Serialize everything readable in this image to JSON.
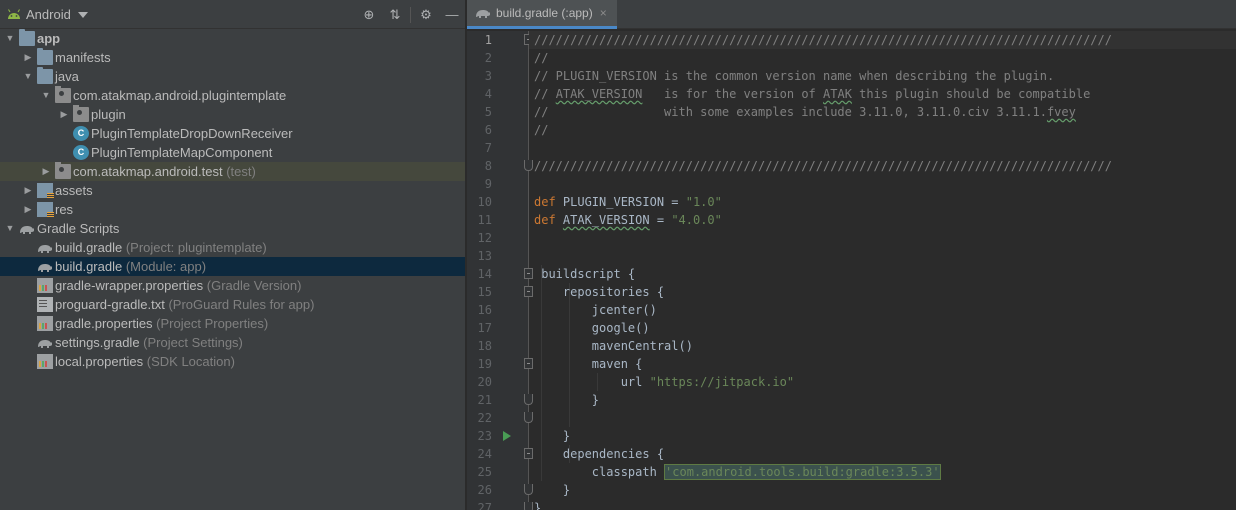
{
  "project_panel": {
    "view_label": "Android",
    "tools": [
      {
        "name": "locate-icon",
        "glyph": "⊕"
      },
      {
        "name": "collapse-all-icon",
        "glyph": "⇅"
      },
      {
        "name": "gear-icon",
        "glyph": "⚙"
      },
      {
        "name": "hide-icon",
        "glyph": "—"
      }
    ],
    "tree": [
      {
        "depth": 0,
        "arrow": "▼",
        "icon": "module",
        "label": "app",
        "hint": "",
        "bold": true
      },
      {
        "depth": 1,
        "arrow": "▶",
        "icon": "folder",
        "label": "manifests",
        "hint": ""
      },
      {
        "depth": 1,
        "arrow": "▼",
        "icon": "folder",
        "label": "java",
        "hint": ""
      },
      {
        "depth": 2,
        "arrow": "▼",
        "icon": "package",
        "label": "com.atakmap.android.plugintemplate",
        "hint": ""
      },
      {
        "depth": 3,
        "arrow": "▶",
        "icon": "package",
        "label": "plugin",
        "hint": ""
      },
      {
        "depth": 3,
        "arrow": "",
        "icon": "class",
        "label": "PluginTemplateDropDownReceiver",
        "hint": ""
      },
      {
        "depth": 3,
        "arrow": "",
        "icon": "class",
        "label": "PluginTemplateMapComponent",
        "hint": ""
      },
      {
        "depth": 2,
        "arrow": "▶",
        "icon": "package",
        "label": "com.atakmap.android.test",
        "hint": "(test)",
        "state": "test"
      },
      {
        "depth": 1,
        "arrow": "▶",
        "icon": "res",
        "label": "assets",
        "hint": ""
      },
      {
        "depth": 1,
        "arrow": "▶",
        "icon": "res",
        "label": "res",
        "hint": ""
      },
      {
        "depth": 0,
        "arrow": "▼",
        "icon": "gradle",
        "label": "Gradle Scripts",
        "hint": ""
      },
      {
        "depth": 1,
        "arrow": "",
        "icon": "gradle",
        "label": "build.gradle",
        "hint": "(Project: plugintemplate)"
      },
      {
        "depth": 1,
        "arrow": "",
        "icon": "gradle",
        "label": "build.gradle",
        "hint": "(Module: app)",
        "state": "selected"
      },
      {
        "depth": 1,
        "arrow": "",
        "icon": "props",
        "label": "gradle-wrapper.properties",
        "hint": "(Gradle Version)"
      },
      {
        "depth": 1,
        "arrow": "",
        "icon": "txt",
        "label": "proguard-gradle.txt",
        "hint": "(ProGuard Rules for app)"
      },
      {
        "depth": 1,
        "arrow": "",
        "icon": "props",
        "label": "gradle.properties",
        "hint": "(Project Properties)"
      },
      {
        "depth": 1,
        "arrow": "",
        "icon": "gradle",
        "label": "settings.gradle",
        "hint": "(Project Settings)"
      },
      {
        "depth": 1,
        "arrow": "",
        "icon": "props",
        "label": "local.properties",
        "hint": "(SDK Location)"
      }
    ]
  },
  "editor": {
    "tab_label": "build.gradle (:app)",
    "tab_close": "×",
    "current_line": 1,
    "run_marker_line": 23,
    "lines": [
      [
        {
          "t": "////////////////////////////////////////////////////////////////////////////////",
          "c": "comment"
        }
      ],
      [
        {
          "t": "//",
          "c": "comment"
        }
      ],
      [
        {
          "t": "// PLUGIN_VERSION is the common version name when describing the plugin.",
          "c": "comment"
        }
      ],
      [
        {
          "t": "// ",
          "c": "comment"
        },
        {
          "t": "ATAK_VERSION",
          "c": "comment typo"
        },
        {
          "t": "   is for the version of ",
          "c": "comment"
        },
        {
          "t": "ATAK",
          "c": "comment typo"
        },
        {
          "t": " this plugin should be compatible",
          "c": "comment"
        }
      ],
      [
        {
          "t": "//                with some examples include 3.11.0, 3.11.0.civ 3.11.1.",
          "c": "comment"
        },
        {
          "t": "fvey",
          "c": "comment typo"
        }
      ],
      [
        {
          "t": "//",
          "c": "comment"
        }
      ],
      [
        {
          "t": "",
          "c": ""
        }
      ],
      [
        {
          "t": "////////////////////////////////////////////////////////////////////////////////",
          "c": "comment"
        }
      ],
      [
        {
          "t": "",
          "c": ""
        }
      ],
      [
        {
          "t": "def",
          "c": "kw"
        },
        {
          "t": " PLUGIN_VERSION = ",
          "c": ""
        },
        {
          "t": "\"1.0\"",
          "c": "str"
        }
      ],
      [
        {
          "t": "def",
          "c": "kw"
        },
        {
          "t": " ",
          "c": ""
        },
        {
          "t": "ATAK_VERSION",
          "c": "typo"
        },
        {
          "t": " = ",
          "c": ""
        },
        {
          "t": "\"4.0.0\"",
          "c": "str"
        }
      ],
      [
        {
          "t": "",
          "c": ""
        }
      ],
      [
        {
          "t": "",
          "c": ""
        }
      ],
      [
        {
          "t": " buildscript {",
          "c": ""
        }
      ],
      [
        {
          "t": "    repositories {",
          "c": ""
        }
      ],
      [
        {
          "t": "        jcenter()",
          "c": ""
        }
      ],
      [
        {
          "t": "        google()",
          "c": ""
        }
      ],
      [
        {
          "t": "        mavenCentral()",
          "c": ""
        }
      ],
      [
        {
          "t": "        maven {",
          "c": ""
        }
      ],
      [
        {
          "t": "            url ",
          "c": ""
        },
        {
          "t": "\"https://jitpack.io\"",
          "c": "str"
        }
      ],
      [
        {
          "t": "        }",
          "c": ""
        }
      ],
      [
        {
          "t": "",
          "c": ""
        }
      ],
      [
        {
          "t": "    }",
          "c": ""
        }
      ],
      [
        {
          "t": "    dependencies {",
          "c": ""
        }
      ],
      [
        {
          "t": "        classpath ",
          "c": ""
        },
        {
          "t": "'com.android.tools.build:gradle:3.5.3'",
          "c": "hl"
        }
      ],
      [
        {
          "t": "    }",
          "c": ""
        }
      ],
      [
        {
          "t": "}",
          "c": ""
        }
      ],
      [
        {
          "t": "",
          "c": ""
        }
      ]
    ],
    "line_numbers": [
      "1",
      "2",
      "3",
      "4",
      "5",
      "6",
      "7",
      "8",
      "9",
      "10",
      "11",
      "12",
      "13",
      "14",
      "15",
      "16",
      "17",
      "18",
      "19",
      "20",
      "21",
      "22",
      "23",
      "24",
      "25",
      "26",
      "27"
    ]
  }
}
